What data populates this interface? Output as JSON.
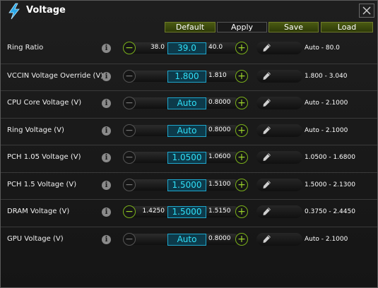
{
  "window": {
    "title": "Voltage",
    "icon": "lightning-icon",
    "close_icon": "close-icon"
  },
  "toolbar": {
    "default_label": "Default",
    "apply_label": "Apply",
    "save_label": "Save",
    "load_label": "Load"
  },
  "rows": [
    {
      "label": "Ring Ratio",
      "min": "38.0",
      "value": "39.0",
      "max": "40.0",
      "range": "Auto - 80.0",
      "minus_enabled": true,
      "plus_enabled": true
    },
    {
      "label": "VCCIN Voltage Override (V)",
      "min": "",
      "value": "1.800",
      "max": "1.810",
      "range": "1.800 - 3.040",
      "minus_enabled": false,
      "plus_enabled": true
    },
    {
      "label": "CPU Core Voltage (V)",
      "min": "",
      "value": "Auto",
      "max": "0.8000",
      "range": "Auto - 2.1000",
      "minus_enabled": false,
      "plus_enabled": true
    },
    {
      "label": "Ring Voltage (V)",
      "min": "",
      "value": "Auto",
      "max": "0.8000",
      "range": "Auto - 2.1000",
      "minus_enabled": false,
      "plus_enabled": true
    },
    {
      "label": "PCH 1.05 Voltage (V)",
      "min": "",
      "value": "1.0500",
      "max": "1.0600",
      "range": "1.0500 - 1.6800",
      "minus_enabled": false,
      "plus_enabled": true
    },
    {
      "label": "PCH 1.5 Voltage (V)",
      "min": "",
      "value": "1.5000",
      "max": "1.5100",
      "range": "1.5000 - 2.1300",
      "minus_enabled": false,
      "plus_enabled": true
    },
    {
      "label": "DRAM Voltage (V)",
      "min": "1.4250",
      "value": "1.5000",
      "max": "1.5150",
      "range": "0.3750 - 2.4450",
      "minus_enabled": true,
      "plus_enabled": true
    },
    {
      "label": "GPU Voltage (V)",
      "min": "",
      "value": "Auto",
      "max": "0.8000",
      "range": "Auto - 2.1000",
      "minus_enabled": false,
      "plus_enabled": true
    }
  ],
  "icons": {
    "info": "info-icon",
    "minus": "minus-icon",
    "plus": "plus-icon",
    "edit": "pencil-icon"
  },
  "glyphs": {
    "info": "i",
    "minus": "−",
    "plus": "+"
  },
  "colors": {
    "accent_green": "#9cd22a",
    "value_cyan": "#2fe0f8",
    "value_border": "#1ea6cc",
    "title_icon_blue": "#2aa8e8"
  }
}
